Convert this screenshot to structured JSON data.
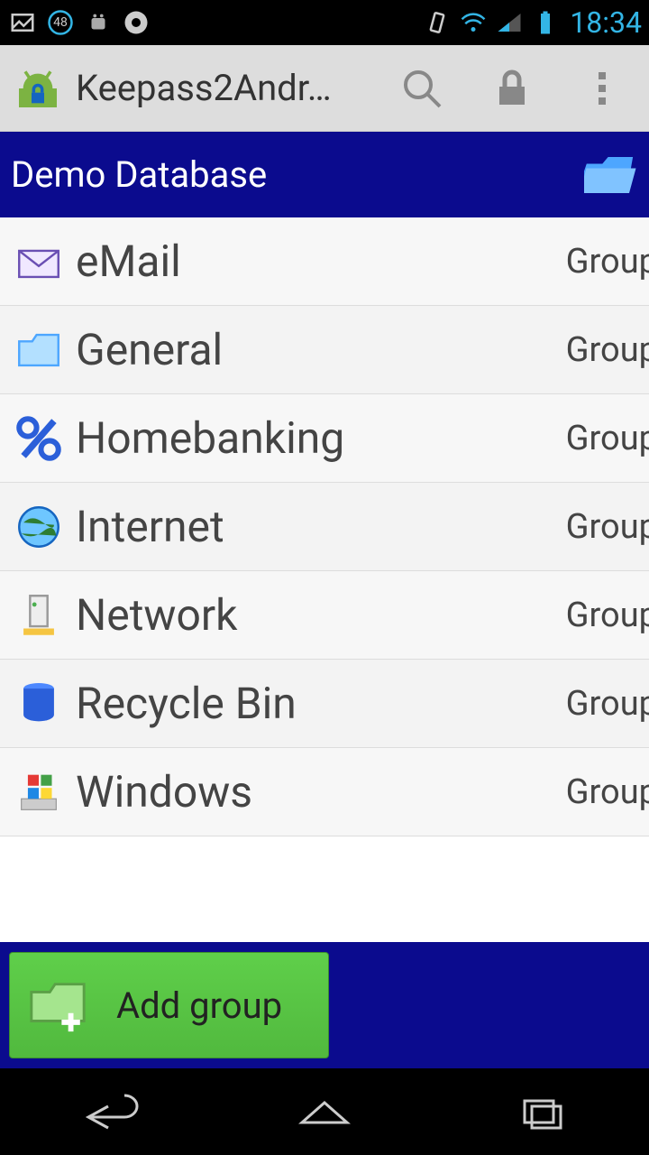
{
  "status": {
    "time": "18:34",
    "notification_count": "48"
  },
  "action_bar": {
    "title": "Keepass2Andr…"
  },
  "db_header": {
    "title": "Demo Database"
  },
  "groups": [
    {
      "label": "eMail",
      "type": "Group",
      "icon": "mail"
    },
    {
      "label": "General",
      "type": "Group",
      "icon": "folder"
    },
    {
      "label": "Homebanking",
      "type": "Group",
      "icon": "percent"
    },
    {
      "label": "Internet",
      "type": "Group",
      "icon": "globe"
    },
    {
      "label": "Network",
      "type": "Group",
      "icon": "server"
    },
    {
      "label": "Recycle Bin",
      "type": "Group",
      "icon": "bin"
    },
    {
      "label": "Windows",
      "type": "Group",
      "icon": "windows"
    }
  ],
  "bottom": {
    "add_group_label": "Add group"
  }
}
